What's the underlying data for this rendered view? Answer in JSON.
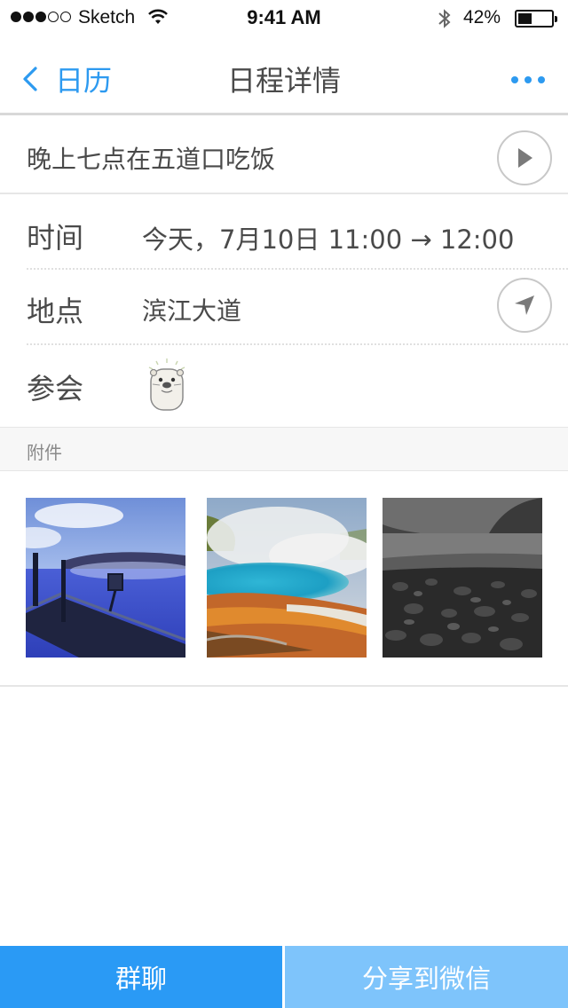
{
  "status_bar": {
    "carrier": "Sketch",
    "time": "9:41 AM",
    "battery_percent": "42%",
    "battery_level": 0.42,
    "signal_dots_filled": 3,
    "signal_dots_total": 5
  },
  "nav": {
    "back_label": "日历",
    "title": "日程详情",
    "more_icon": "more-dots-icon"
  },
  "event": {
    "title": "晚上七点在五道口吃饭",
    "play_icon": "play-icon"
  },
  "details": {
    "time_label": "时间",
    "time_value": "今天，7月10日 11:00 → 12:00",
    "location_label": "地点",
    "location_value": "滨江大道",
    "location_icon": "navigation-arrow-icon",
    "attendees_label": "参会",
    "attendee_avatar": "otter-avatar-icon"
  },
  "attachments": {
    "header": "附件",
    "items": [
      "blue-lagoon-photo",
      "hot-spring-photo",
      "pebble-beach-photo"
    ]
  },
  "actions": {
    "group_chat": "群聊",
    "share_wechat": "分享到微信"
  },
  "colors": {
    "accent": "#2d9af0",
    "primary_button": "#2a9af5",
    "secondary_button": "#7ec4fb",
    "text": "#4a4a4a"
  }
}
